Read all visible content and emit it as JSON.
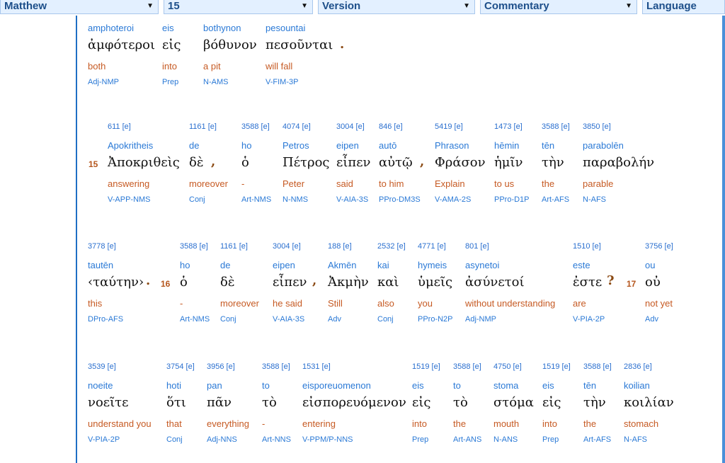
{
  "toolbar": {
    "book": "Matthew",
    "chapter": "15",
    "version": "Version",
    "commentary": "Commentary",
    "language": "Language"
  },
  "rows": [
    {
      "words": [
        {
          "tr": "amphoteroi",
          "gk": "ἀμφότεροι",
          "en": "both",
          "mo": "Adj-NMP"
        },
        {
          "tr": "eis",
          "gk": "εἰς",
          "en": "into",
          "mo": "Prep"
        },
        {
          "tr": "bothynon",
          "gk": "βόθυνον",
          "en": "a pit",
          "mo": "N-AMS"
        },
        {
          "tr": "pesountai",
          "gk": "πεσοῦνται",
          "en": "will fall",
          "mo": "V-FIM-3P"
        }
      ],
      "punct": [
        "."
      ],
      "verses": []
    },
    {
      "words": [
        {
          "num": "611 [e]",
          "tr": "Apokritheis",
          "gk": "Ἀποκριθεὶς",
          "en": "answering",
          "mo": "V-APP-NMS"
        },
        {
          "num": "1161 [e]",
          "tr": "de",
          "gk": "δὲ",
          "en": "moreover",
          "mo": "Conj"
        },
        {
          "num": "3588 [e]",
          "tr": "ho",
          "gk": "ὁ",
          "en": "-",
          "mo": "Art-NMS"
        },
        {
          "num": "4074 [e]",
          "tr": "Petros",
          "gk": "Πέτρος",
          "en": "Peter",
          "mo": "N-NMS"
        },
        {
          "num": "3004 [e]",
          "tr": "eipen",
          "gk": "εἶπεν",
          "en": "said",
          "mo": "V-AIA-3S"
        },
        {
          "num": "846 [e]",
          "tr": "autō",
          "gk": "αὐτῷ",
          "en": "to him",
          "mo": "PPro-DM3S"
        },
        {
          "num": "5419 [e]",
          "tr": "Phrason",
          "gk": "Φράσον",
          "en": "Explain",
          "mo": "V-AMA-2S"
        },
        {
          "num": "1473 [e]",
          "tr": "hēmin",
          "gk": "ἡμῖν",
          "en": "to us",
          "mo": "PPro-D1P"
        },
        {
          "num": "3588 [e]",
          "tr": "tēn",
          "gk": "τὴν",
          "en": "the",
          "mo": "Art-AFS"
        },
        {
          "num": "3850 [e]",
          "tr": "parabolēn",
          "gk": "παραβολήν",
          "en": "parable",
          "mo": "N-AFS"
        }
      ],
      "punct": [
        ",",
        ","
      ],
      "verses": [
        "15"
      ]
    },
    {
      "words": [
        {
          "num": "3778 [e]",
          "tr": "tautēn",
          "gk": "‹ταύτην›",
          "en": "this",
          "mo": "DPro-AFS"
        },
        {
          "num": "3588 [e]",
          "tr": "ho",
          "gk": "ὁ",
          "en": "-",
          "mo": "Art-NMS"
        },
        {
          "num": "1161 [e]",
          "tr": "de",
          "gk": "δὲ",
          "en": "moreover",
          "mo": "Conj"
        },
        {
          "num": "3004 [e]",
          "tr": "eipen",
          "gk": "εἶπεν",
          "en": "he said",
          "mo": "V-AIA-3S"
        },
        {
          "num": "188 [e]",
          "tr": "Akmēn",
          "gk": "Ἀκμὴν",
          "en": "Still",
          "mo": "Adv"
        },
        {
          "num": "2532 [e]",
          "tr": "kai",
          "gk": "καὶ",
          "en": "also",
          "mo": "Conj"
        },
        {
          "num": "4771 [e]",
          "tr": "hymeis",
          "gk": "ὑμεῖς",
          "en": "you",
          "mo": "PPro-N2P"
        },
        {
          "num": "801 [e]",
          "tr": "asynetoi",
          "gk": "ἀσύνετοί",
          "en": "without understanding",
          "mo": "Adj-NMP"
        },
        {
          "num": "1510 [e]",
          "tr": "este",
          "gk": "ἐστε",
          "en": "are",
          "mo": "V-PIA-2P"
        },
        {
          "num": "3756 [e]",
          "tr": "ou",
          "gk": "οὐ",
          "en": "not yet",
          "mo": "Adv"
        }
      ],
      "punct": [
        ".",
        ",",
        "?"
      ],
      "verses": [
        "16",
        "17"
      ]
    },
    {
      "words": [
        {
          "num": "3539 [e]",
          "tr": "noeite",
          "gk": "νοεῖτε",
          "en": "understand you",
          "mo": "V-PIA-2P"
        },
        {
          "num": "3754 [e]",
          "tr": "hoti",
          "gk": "ὅτι",
          "en": "that",
          "mo": "Conj"
        },
        {
          "num": "3956 [e]",
          "tr": "pan",
          "gk": "πᾶν",
          "en": "everything",
          "mo": "Adj-NNS"
        },
        {
          "num": "3588 [e]",
          "tr": "to",
          "gk": "τὸ",
          "en": "-",
          "mo": "Art-NNS"
        },
        {
          "num": "1531 [e]",
          "tr": "eisporeuomenon",
          "gk": "εἰσπορευόμενον",
          "en": "entering",
          "mo": "V-PPM/P-NNS"
        },
        {
          "num": "1519 [e]",
          "tr": "eis",
          "gk": "εἰς",
          "en": "into",
          "mo": "Prep"
        },
        {
          "num": "3588 [e]",
          "tr": "to",
          "gk": "τὸ",
          "en": "the",
          "mo": "Art-ANS"
        },
        {
          "num": "4750 [e]",
          "tr": "stoma",
          "gk": "στόμα",
          "en": "mouth",
          "mo": "N-ANS"
        },
        {
          "num": "1519 [e]",
          "tr": "eis",
          "gk": "εἰς",
          "en": "into",
          "mo": "Prep"
        },
        {
          "num": "3588 [e]",
          "tr": "tēn",
          "gk": "τὴν",
          "en": "the",
          "mo": "Art-AFS"
        },
        {
          "num": "2836 [e]",
          "tr": "koilian",
          "gk": "κοιλίαν",
          "en": "stomach",
          "mo": "N-AFS"
        }
      ],
      "punct": [],
      "verses": []
    }
  ]
}
